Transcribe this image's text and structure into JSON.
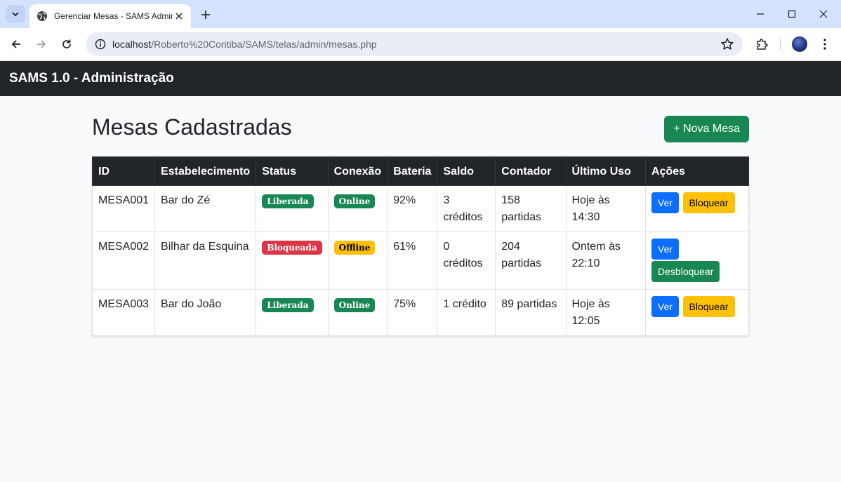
{
  "browser": {
    "tab_title": "Gerenciar Mesas - SAMS Admin",
    "url_host": "localhost",
    "url_path": "/Roberto%20Coritiba/SAMS/telas/admin/mesas.php"
  },
  "navbar": {
    "brand": "SAMS 1.0 - Administração"
  },
  "page": {
    "title": "Mesas Cadastradas",
    "new_button": "+ Nova Mesa"
  },
  "table": {
    "headers": [
      "ID",
      "Estabelecimento",
      "Status",
      "Conexão",
      "Bateria",
      "Saldo",
      "Contador",
      "Último Uso",
      "Ações"
    ],
    "rows": [
      {
        "id": "MESA001",
        "estabelecimento": "Bar do Zé",
        "status": "Liberada",
        "conexao": "Online",
        "bateria": "92%",
        "saldo": "3 créditos",
        "contador": "158 partidas",
        "ultimo_uso": "Hoje às 14:30",
        "btn_ver": "Ver",
        "btn_action": "Bloquear"
      },
      {
        "id": "MESA002",
        "estabelecimento": "Bilhar da Esquina",
        "status": "Bloqueada",
        "conexao": "Offline",
        "bateria": "61%",
        "saldo": "0 créditos",
        "contador": "204 partidas",
        "ultimo_uso": "Ontem às 22:10",
        "btn_ver": "Ver",
        "btn_action": "Desbloquear"
      },
      {
        "id": "MESA003",
        "estabelecimento": "Bar do João",
        "status": "Liberada",
        "conexao": "Online",
        "bateria": "75%",
        "saldo": "1 crédito",
        "contador": "89 partidas",
        "ultimo_uso": "Hoje às 12:05",
        "btn_ver": "Ver",
        "btn_action": "Bloquear"
      }
    ]
  },
  "colors": {
    "navbar": "#212529",
    "success": "#198754",
    "danger": "#dc3545",
    "warning": "#ffc107",
    "primary": "#0d6efd"
  }
}
